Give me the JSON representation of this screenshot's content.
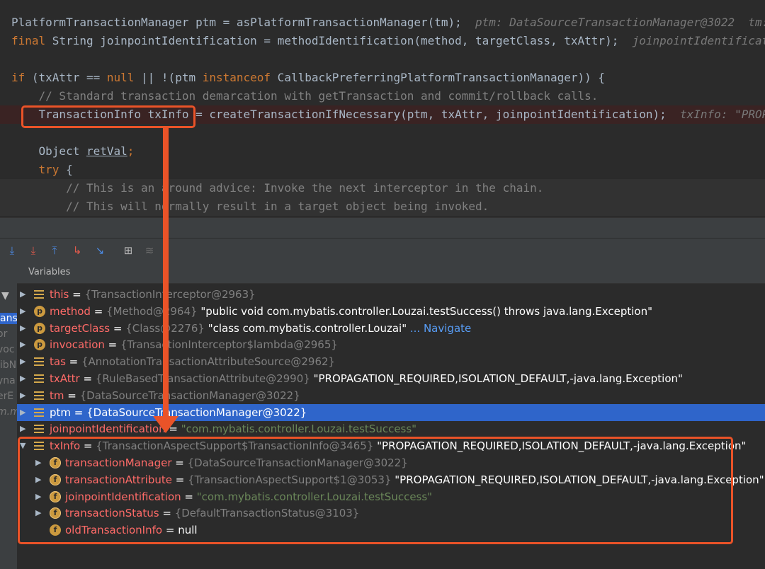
{
  "code_lines": [
    {
      "segs": [
        {
          "t": "PlatformTransactionManager ptm = asPlatformTransactionManager(tm);",
          "c": ""
        },
        {
          "t": "  ptm: DataSourceTransactionManager@3022  tm: ",
          "c": "h"
        }
      ]
    },
    {
      "segs": [
        {
          "t": "final",
          "c": "k"
        },
        {
          "t": " String joinpointIdentification = methodIdentification(method, targetClass, txAttr);",
          "c": ""
        },
        {
          "t": "  joinpointIdentificati",
          "c": "h"
        }
      ]
    },
    {
      "segs": []
    },
    {
      "segs": [
        {
          "t": "if",
          "c": "k"
        },
        {
          "t": " (txAttr == ",
          "c": ""
        },
        {
          "t": "null",
          "c": "k"
        },
        {
          "t": " || !(ptm ",
          "c": ""
        },
        {
          "t": "instanceof",
          "c": "k"
        },
        {
          "t": " CallbackPreferringPlatformTransactionManager)) {",
          "c": ""
        }
      ]
    },
    {
      "segs": [
        {
          "t": "    // Standard transaction demarcation with getTransaction and commit/rollback calls.",
          "c": "c"
        }
      ]
    },
    {
      "segs": [
        {
          "t": "    TransactionInfo txInfo = createTransactionIfNecessary(ptm, txAttr, joinpointIdentification);",
          "c": ""
        },
        {
          "t": "  txInfo: \"PROPA",
          "c": "h"
        }
      ]
    },
    {
      "segs": []
    },
    {
      "segs": [
        {
          "t": "    Object ",
          "c": ""
        },
        {
          "t": "retVal",
          "c": "u"
        },
        {
          "t": ";",
          "c": "k"
        }
      ]
    },
    {
      "segs": [
        {
          "t": "    try",
          "c": "k"
        },
        {
          "t": " {",
          "c": ""
        }
      ]
    },
    {
      "segs": [
        {
          "t": "        // This is an around advice: Invoke the next interceptor in the chain.",
          "c": "c"
        }
      ]
    },
    {
      "segs": [
        {
          "t": "        // This will normally result in a target object being invoked.",
          "c": "c"
        }
      ]
    }
  ],
  "toolbar_icons": [
    "step-over-icon",
    "step-into-icon",
    "force-step-into-icon",
    "step-out-icon",
    "drop-frame-icon",
    "run-to-cursor-icon",
    "evaluate-expression-icon",
    "trace-stream-icon"
  ],
  "frames_strip": [
    "ans",
    "or",
    "voc",
    "libN",
    "yna",
    "erE",
    "m.m"
  ],
  "variables_header": "Variables",
  "variables": [
    {
      "name": "this",
      "type": "{TransactionInterceptor@2963}",
      "value": "",
      "icon": "field-list-icon",
      "expanded": false,
      "depth": 0
    },
    {
      "name": "method",
      "type": "{Method@2964}",
      "value": "\"public void com.mybatis.controller.Louzai.testSuccess() throws java.lang.Exception\"",
      "icon": "parameter-icon",
      "expanded": false,
      "depth": 0
    },
    {
      "name": "targetClass",
      "type": "{Class@2276}",
      "value": "\"class com.mybatis.controller.Louzai\"",
      "icon": "parameter-icon",
      "expanded": false,
      "depth": 0,
      "navigate": "... Navigate"
    },
    {
      "name": "invocation",
      "type": "{TransactionInterceptor$lambda@2965}",
      "value": "",
      "icon": "parameter-icon",
      "expanded": false,
      "depth": 0
    },
    {
      "name": "tas",
      "type": "{AnnotationTransactionAttributeSource@2962}",
      "value": "",
      "icon": "field-list-icon",
      "expanded": false,
      "depth": 0
    },
    {
      "name": "txAttr",
      "type": "{RuleBasedTransactionAttribute@2990}",
      "value": "\"PROPAGATION_REQUIRED,ISOLATION_DEFAULT,-java.lang.Exception\"",
      "icon": "field-list-icon",
      "expanded": false,
      "depth": 0
    },
    {
      "name": "tm",
      "type": "{DataSourceTransactionManager@3022}",
      "value": "",
      "icon": "field-list-icon",
      "expanded": false,
      "depth": 0
    },
    {
      "name": "ptm",
      "type": "{DataSourceTransactionManager@3022}",
      "value": "",
      "icon": "field-list-icon",
      "expanded": false,
      "depth": 0,
      "selected": true
    },
    {
      "name": "joinpointIdentification",
      "type": "",
      "value": "\"com.mybatis.controller.Louzai.testSuccess\"",
      "icon": "field-list-icon",
      "expanded": false,
      "depth": 0,
      "string": true
    },
    {
      "name": "txInfo",
      "type": "{TransactionAspectSupport$TransactionInfo@3465}",
      "value": "\"PROPAGATION_REQUIRED,ISOLATION_DEFAULT,-java.lang.Exception\"",
      "icon": "field-list-icon",
      "expanded": true,
      "depth": 0
    },
    {
      "name": "transactionManager",
      "type": "{DataSourceTransactionManager@3022}",
      "value": "",
      "icon": "final-field-icon",
      "expanded": false,
      "depth": 1
    },
    {
      "name": "transactionAttribute",
      "type": "{TransactionAspectSupport$1@3053}",
      "value": "\"PROPAGATION_REQUIRED,ISOLATION_DEFAULT,-java.lang.Exception\"",
      "icon": "final-field-icon",
      "expanded": false,
      "depth": 1
    },
    {
      "name": "joinpointIdentification",
      "type": "",
      "value": "\"com.mybatis.controller.Louzai.testSuccess\"",
      "icon": "final-field-icon",
      "expanded": false,
      "depth": 1,
      "string": true
    },
    {
      "name": "transactionStatus",
      "type": "{DefaultTransactionStatus@3103}",
      "value": "",
      "icon": "final-field-icon",
      "expanded": false,
      "depth": 1
    },
    {
      "name": "oldTransactionInfo",
      "type": "",
      "value": "null",
      "icon": "field-icon",
      "expanded": false,
      "depth": 1,
      "leaf": true
    }
  ],
  "colors": {
    "annotation": "#ea5328",
    "selection": "#2f65ca",
    "name": "#ff6b68",
    "string": "#6a8759"
  }
}
